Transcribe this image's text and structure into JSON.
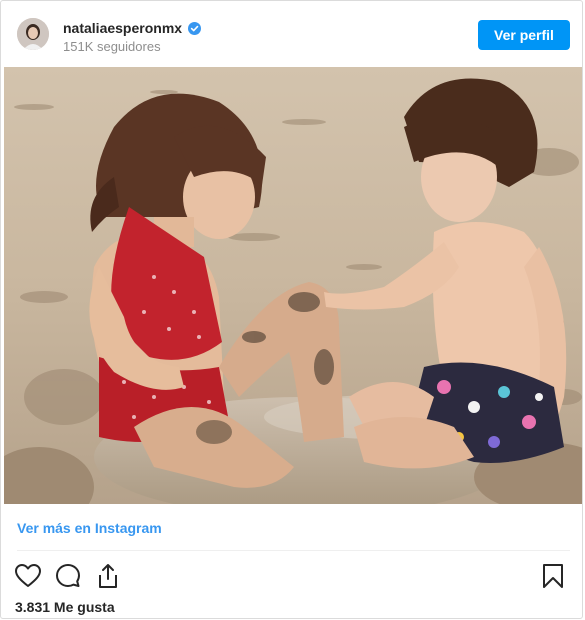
{
  "header": {
    "username": "nataliaesperonmx",
    "followers": "151K seguidores",
    "profile_button": "Ver perfil",
    "verified_icon": "verified-badge-icon"
  },
  "post": {
    "more_link": "Ver más en Instagram",
    "likes": "3.831 Me gusta"
  },
  "icons": {
    "like": "heart-icon",
    "comment": "comment-icon",
    "share": "share-icon",
    "save": "bookmark-icon"
  },
  "colors": {
    "accent": "#0095f6",
    "link": "#3897f0",
    "text": "#262626",
    "muted": "#8e8e8e"
  }
}
